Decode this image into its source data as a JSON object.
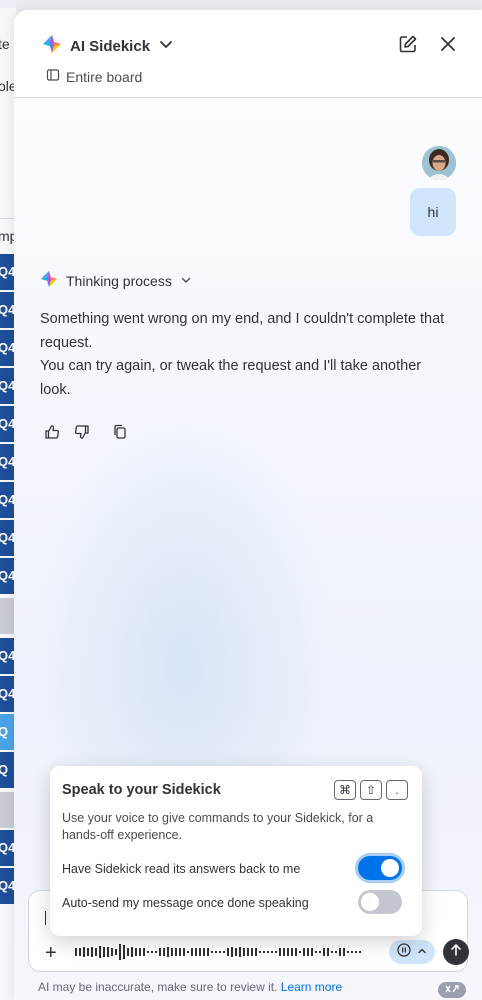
{
  "board": {
    "fragments": [
      "te",
      "ole",
      "mp"
    ],
    "rows": [
      "Q4",
      "Q4",
      "Q4",
      "Q4",
      "Q4",
      "Q4",
      "Q4",
      "Q4",
      "Q4",
      "",
      "Q4",
      "Q4",
      "Q",
      "Q",
      "",
      "Q4",
      "Q4"
    ]
  },
  "header": {
    "title": "AI Sidekick",
    "scope": "Entire board"
  },
  "conversation": {
    "user_message": "hi",
    "thinking_label": "Thinking process",
    "answer_line1": "Something went wrong on my end, and I couldn't complete that request.",
    "answer_line2": "You can try again, or tweak the request and I'll take another look."
  },
  "popover": {
    "title": "Speak to your Sidekick",
    "shortcut_keys": [
      "⌘",
      "⇧",
      "."
    ],
    "description": "Use your voice to give commands to your Sidekick, for a hands-off experience.",
    "options": [
      {
        "label": "Have Sidekick read its answers back to me",
        "enabled": true
      },
      {
        "label": "Auto-send my message once done speaking",
        "enabled": false
      }
    ]
  },
  "composer": {
    "plus_label": "+"
  },
  "footer": {
    "disclaimer": "AI may be inaccurate, make sure to review it.",
    "learn_more": "Learn more"
  },
  "colors": {
    "accent": "#0073ea",
    "user_bubble": "#cfe5fb",
    "board_dark": "#1f4e9a",
    "board_light": "#4aa3e8"
  }
}
